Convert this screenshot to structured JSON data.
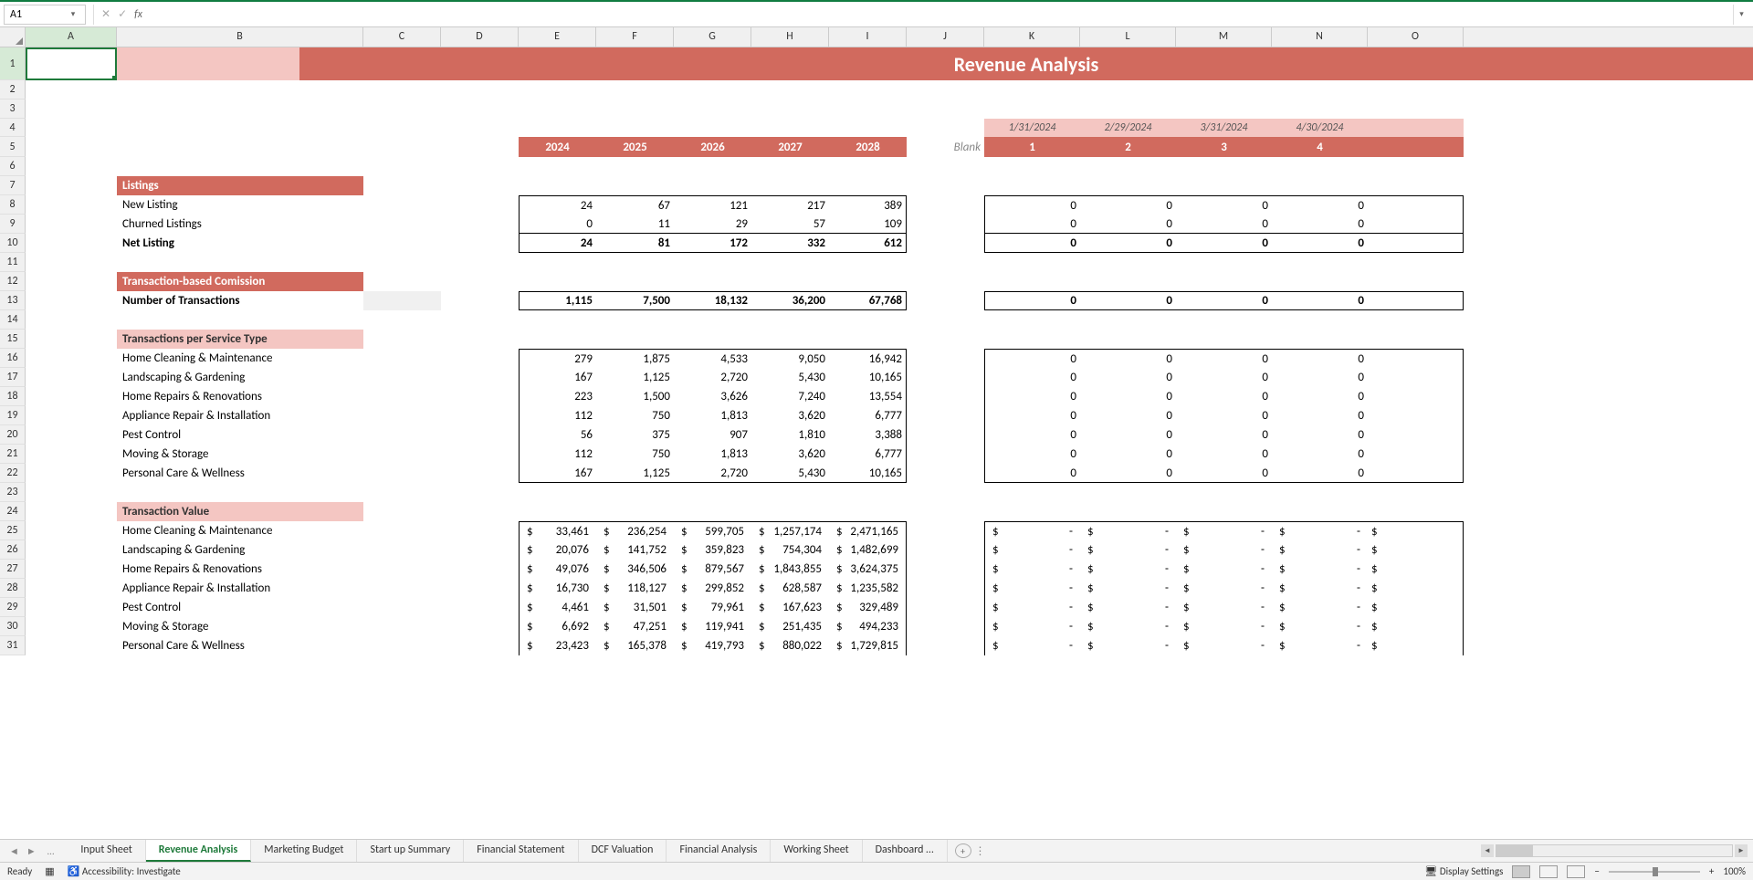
{
  "nameBox": "A1",
  "formula": "",
  "title": "Revenue Analysis",
  "columns": [
    "A",
    "B",
    "C",
    "D",
    "E",
    "F",
    "G",
    "H",
    "I",
    "J",
    "K",
    "L",
    "M",
    "N",
    "O"
  ],
  "dates": [
    "1/31/2024",
    "2/29/2024",
    "3/31/2024",
    "4/30/2024"
  ],
  "periods": [
    "1",
    "2",
    "3",
    "4"
  ],
  "years": [
    "2024",
    "2025",
    "2026",
    "2027",
    "2028"
  ],
  "blankLabel": "Blank",
  "sections": {
    "listings": "Listings",
    "newListing": "New Listing",
    "churned": "Churned Listings",
    "netListing": "Net Listing",
    "txComm": "Transaction-based Comission",
    "numTx": "Number of Transactions",
    "perType": "Transactions per Service Type",
    "txValue": "Transaction Value",
    "svc1": "Home Cleaning & Maintenance",
    "svc2": "Landscaping & Gardening",
    "svc3": "Home Repairs & Renovations",
    "svc4": "Appliance Repair & Installation",
    "svc5": "Pest Control",
    "svc6": "Moving & Storage",
    "svc7": "Personal Care & Wellness"
  },
  "vals": {
    "newListing": [
      "24",
      "67",
      "121",
      "217",
      "389"
    ],
    "churned": [
      "0",
      "11",
      "29",
      "57",
      "109"
    ],
    "netListing": [
      "24",
      "81",
      "172",
      "332",
      "612"
    ],
    "numTx": [
      "1,115",
      "7,500",
      "18,132",
      "36,200",
      "67,768"
    ],
    "svc1": [
      "279",
      "1,875",
      "4,533",
      "9,050",
      "16,942"
    ],
    "svc2": [
      "167",
      "1,125",
      "2,720",
      "5,430",
      "10,165"
    ],
    "svc3": [
      "223",
      "1,500",
      "3,626",
      "7,240",
      "13,554"
    ],
    "svc4": [
      "112",
      "750",
      "1,813",
      "3,620",
      "6,777"
    ],
    "svc5": [
      "56",
      "375",
      "907",
      "1,810",
      "3,388"
    ],
    "svc6": [
      "112",
      "750",
      "1,813",
      "3,620",
      "6,777"
    ],
    "svc7": [
      "167",
      "1,125",
      "2,720",
      "5,430",
      "10,165"
    ],
    "tv1": [
      "33,461",
      "236,254",
      "599,705",
      "1,257,174",
      "2,471,165"
    ],
    "tv2": [
      "20,076",
      "141,752",
      "359,823",
      "754,304",
      "1,482,699"
    ],
    "tv3": [
      "49,076",
      "346,506",
      "879,567",
      "1,843,855",
      "3,624,375"
    ],
    "tv4": [
      "16,730",
      "118,127",
      "299,852",
      "628,587",
      "1,235,582"
    ],
    "tv5": [
      "4,461",
      "31,501",
      "79,961",
      "167,623",
      "329,489"
    ],
    "tv6": [
      "6,692",
      "47,251",
      "119,941",
      "251,435",
      "494,233"
    ],
    "tv7": [
      "23,423",
      "165,378",
      "419,793",
      "880,022",
      "1,729,815"
    ]
  },
  "zeroRow": [
    "0",
    "0",
    "0",
    "0"
  ],
  "dashRow": [
    "-",
    "-",
    "-",
    "-"
  ],
  "dollar": "$",
  "tabs": [
    "Input Sheet",
    "Revenue Analysis",
    "Marketing Budget",
    "Start up Summary",
    "Financial Statement",
    "DCF Valuation",
    "Financial Analysis",
    "Working Sheet",
    "Dashboard …"
  ],
  "activeTab": 1,
  "status": {
    "ready": "Ready",
    "accessibility": "Accessibility: Investigate",
    "display": "Display Settings",
    "zoom": "100%"
  }
}
